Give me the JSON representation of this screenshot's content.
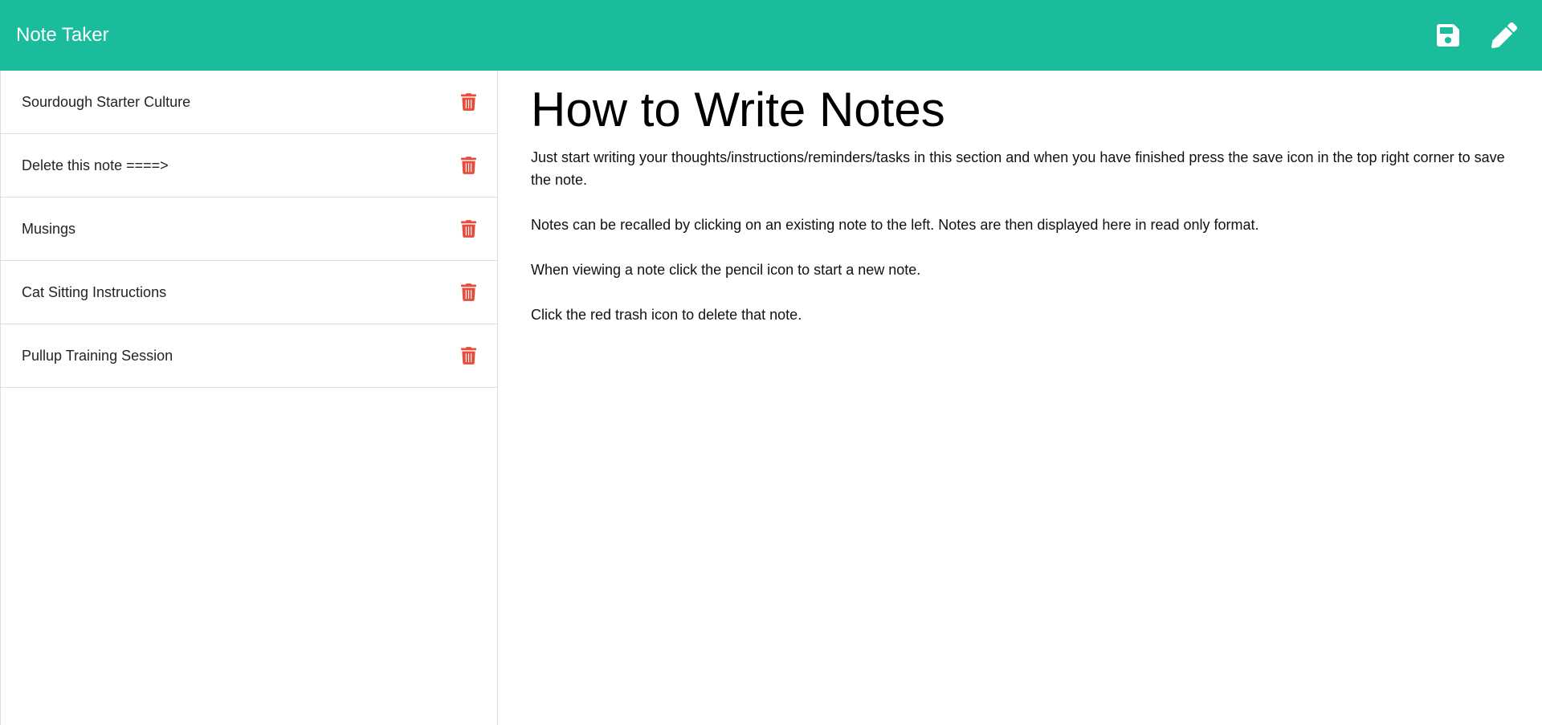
{
  "app": {
    "title": "Note Taker"
  },
  "toolbar": {
    "save_icon": "save-icon",
    "new_note_icon": "pencil-icon"
  },
  "colors": {
    "navbar": "#1abc9c",
    "trash": "#e74c3c",
    "icon_white": "#ffffff"
  },
  "sidebar": {
    "notes": [
      {
        "title": "Sourdough Starter Culture"
      },
      {
        "title": "Delete this note ====>"
      },
      {
        "title": "Musings"
      },
      {
        "title": "Cat Sitting Instructions"
      },
      {
        "title": "Pullup Training Session"
      }
    ]
  },
  "main": {
    "title": "How to Write Notes",
    "paragraphs": [
      "Just start writing your thoughts/instructions/reminders/tasks in this section and when you have finished press the save icon in the top right corner to save the note.",
      "Notes can be recalled by clicking on an existing note to the left. Notes are then displayed here in read only format.",
      "When viewing a note click the pencil icon to start a new note.",
      "Click the red trash icon to delete that note."
    ]
  }
}
